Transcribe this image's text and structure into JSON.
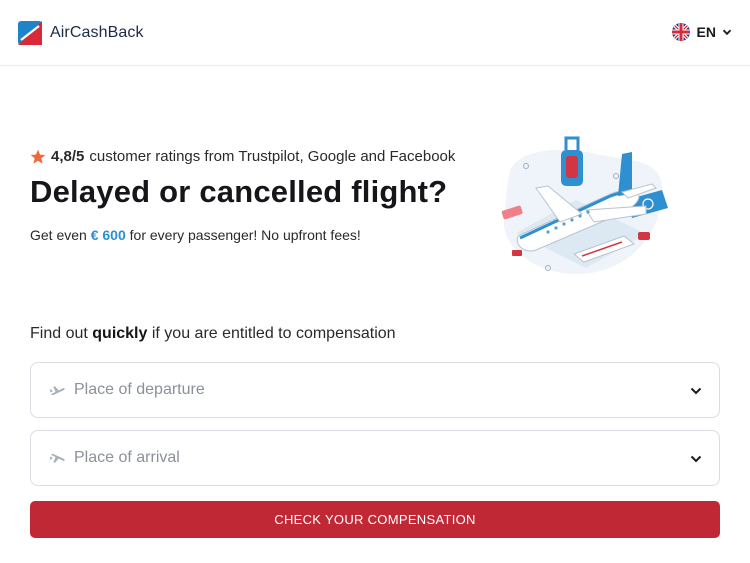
{
  "brand": {
    "name": "AirCashBack"
  },
  "language": {
    "code": "EN",
    "flag_icon": "uk-flag-icon"
  },
  "hero": {
    "rating_score": "4,8/5",
    "rating_text": "customer ratings from Trustpilot, Google and Facebook",
    "title": "Delayed or cancelled flight?",
    "subtitle_before": "Get even",
    "amount": "€ 600",
    "subtitle_after": "for every passenger! No upfront fees!"
  },
  "form": {
    "question_before": "Find out",
    "question_bold": "quickly",
    "question_after": "if you are entitled to compensation",
    "departure_placeholder": "Place of departure",
    "arrival_placeholder": "Place of arrival",
    "submit_label": "CHECK YOUR COMPENSATION"
  },
  "colors": {
    "accent": "#c12836",
    "amount": "#2e8fd1",
    "star": "#ef6a3a"
  }
}
